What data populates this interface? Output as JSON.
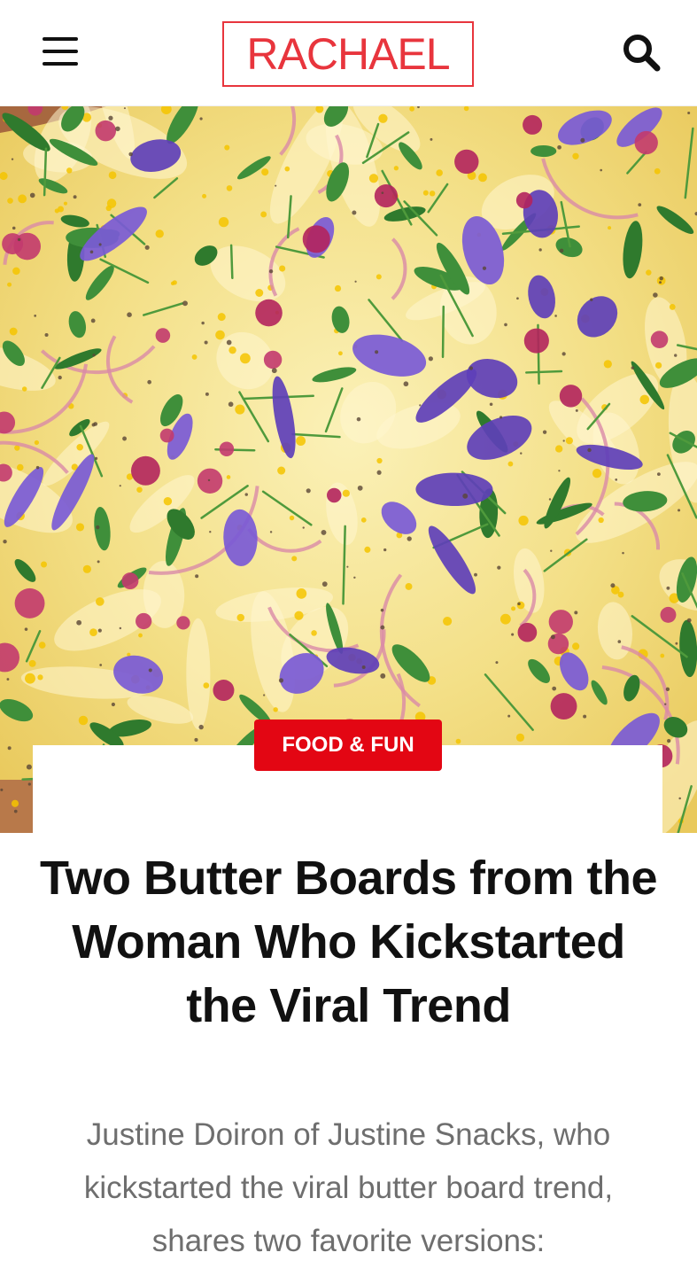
{
  "header": {
    "logo_text": "RACHAEL",
    "menu_icon": "hamburger-menu-icon",
    "search_icon": "search-icon"
  },
  "hero": {
    "image_description_icon": "butter-board-photo"
  },
  "article": {
    "category": "FOOD & FUN",
    "title": "Two Butter Boards from the Woman Who Kickstarted the Viral Trend",
    "dek": "Justine Doiron of Justine Snacks, who kickstarted the viral butter board trend, shares two favorite versions:"
  },
  "colors": {
    "brand_red": "#e8353d",
    "badge_red": "#e30613",
    "title_color": "#111111",
    "dek_color": "#6e6e6e"
  }
}
